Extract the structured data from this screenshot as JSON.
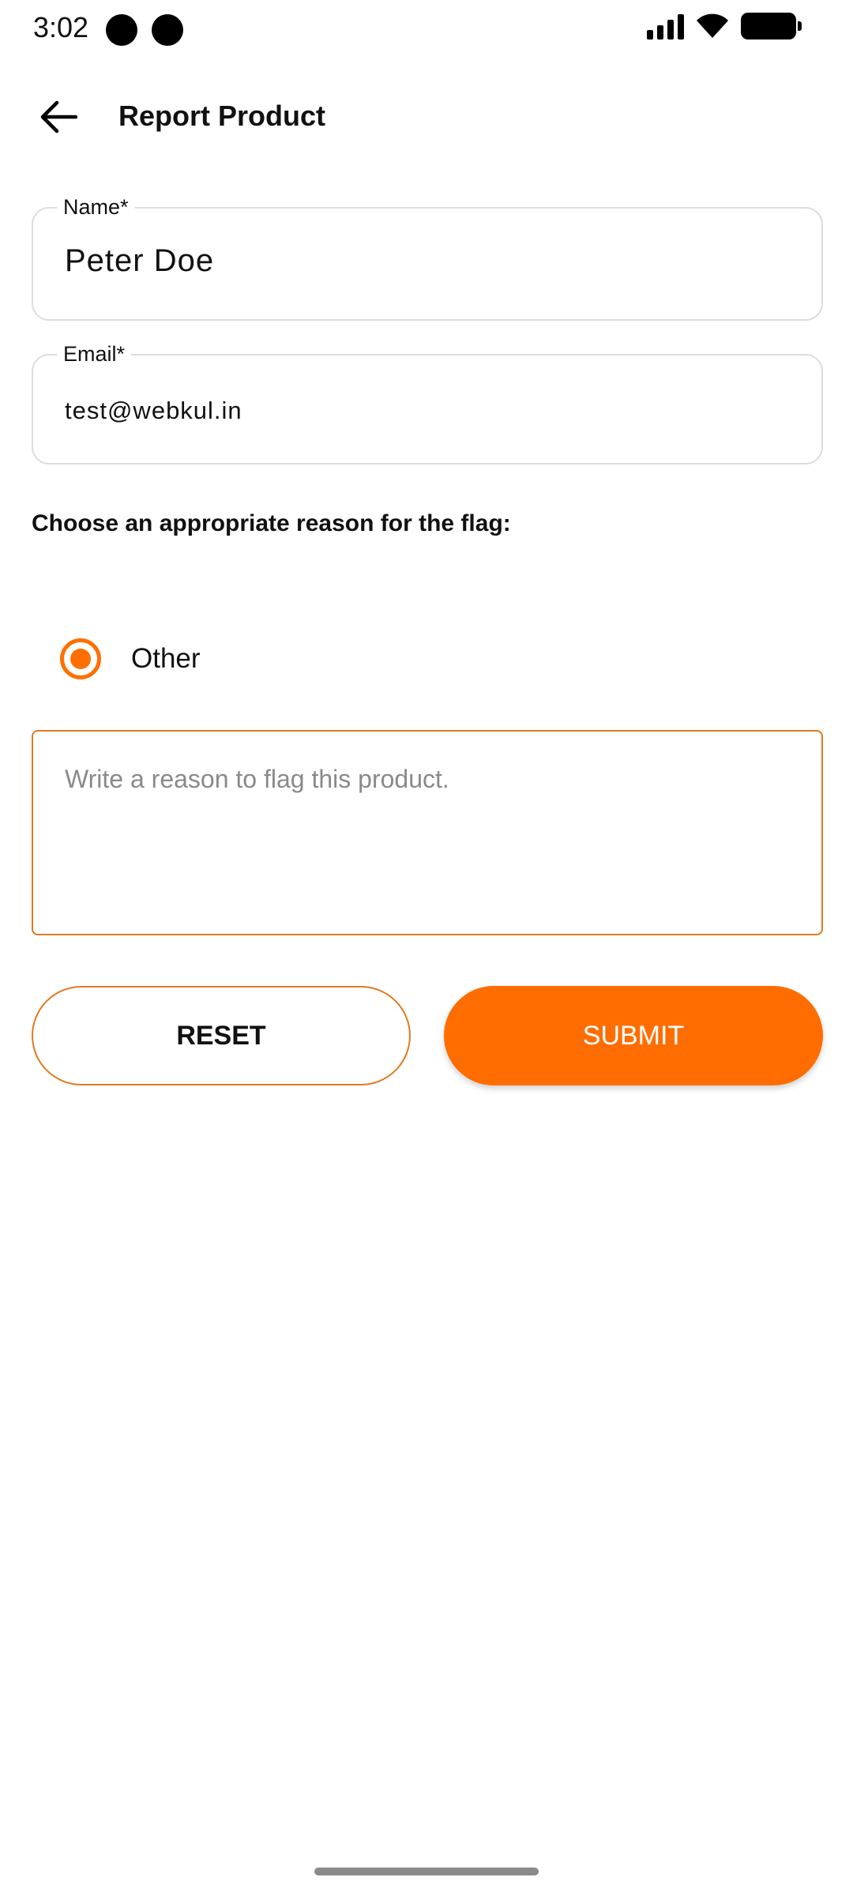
{
  "status_bar": {
    "time": "3:02"
  },
  "app_bar": {
    "title": "Report Product",
    "back_icon": "arrow-back-icon"
  },
  "form": {
    "name": {
      "label": "Name*",
      "value": "Peter Doe"
    },
    "email": {
      "label": "Email*",
      "value": "test@webkul.in"
    },
    "reason_prompt": "Choose an appropriate reason for the flag:",
    "reason_option": {
      "label": "Other",
      "selected": true
    },
    "reason_text": {
      "value": "",
      "placeholder": "Write a reason to flag this product."
    }
  },
  "buttons": {
    "reset": "RESET",
    "submit": "SUBMIT"
  },
  "colors": {
    "accent": "#ff6d00",
    "border": "#dcdcdc"
  }
}
